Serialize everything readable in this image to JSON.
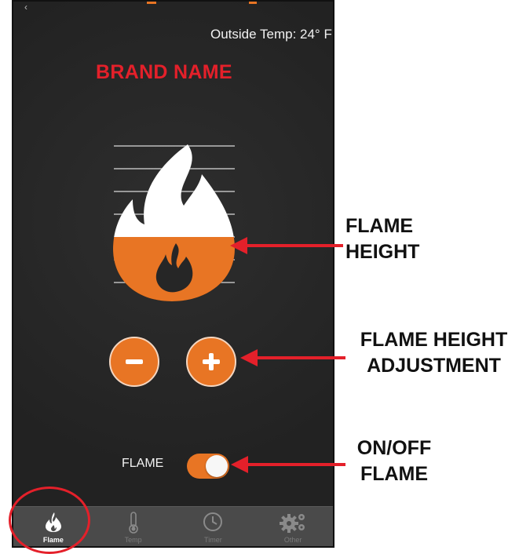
{
  "screen": {
    "outside_temp": "Outside Temp: 24° F",
    "brand": "BRAND NAME",
    "flame_label": "FLAME",
    "flame_height_level": 0.5,
    "flame_on": true
  },
  "tabs": [
    {
      "label": "Flame",
      "icon": "flame-icon",
      "active": true
    },
    {
      "label": "Temp",
      "icon": "thermometer-icon",
      "active": false
    },
    {
      "label": "Timer",
      "icon": "clock-icon",
      "active": false
    },
    {
      "label": "Other",
      "icon": "gears-icon",
      "active": false
    }
  ],
  "callouts": {
    "flame_height_1": "FLAME",
    "flame_height_2": "HEIGHT",
    "adjust_1": "FLAME HEIGHT",
    "adjust_2": "ADJUSTMENT",
    "onoff_1": "ON/OFF",
    "onoff_2": "FLAME"
  },
  "colors": {
    "accent": "#e87524",
    "brand": "#e4202a",
    "background": "#262626",
    "annotation": "#e4202a"
  }
}
